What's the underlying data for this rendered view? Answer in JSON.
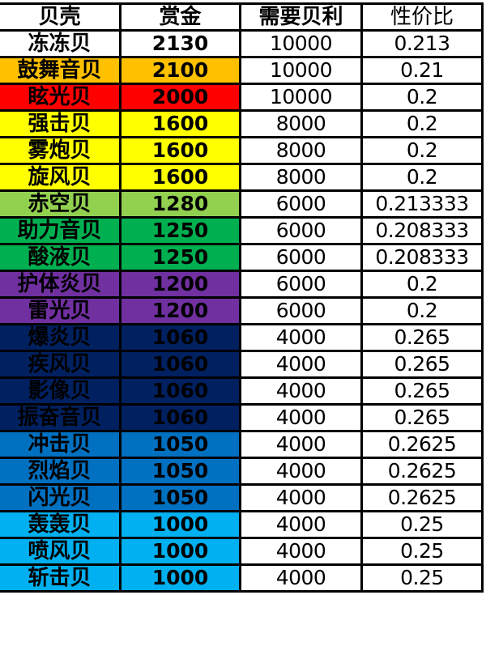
{
  "headers": {
    "shell": "贝壳",
    "bounty": "赏金",
    "required_berry": "需要贝利",
    "value_ratio": "性价比"
  },
  "tier_colors": {
    "white": "#FFFFFF",
    "orange": "#FFC000",
    "red": "#FF0000",
    "yellow": "#FFFF00",
    "light_green": "#92D050",
    "green": "#00B050",
    "purple": "#7030A0",
    "navy": "#002060",
    "blue": "#0070C0",
    "light_blue": "#00B0F0"
  },
  "rows": [
    {
      "name": "冻冻贝",
      "bounty": "2130",
      "berry": "10000",
      "ratio": "0.213",
      "tier": "white"
    },
    {
      "name": "鼓舞音贝",
      "bounty": "2100",
      "berry": "10000",
      "ratio": "0.21",
      "tier": "orange"
    },
    {
      "name": "眩光贝",
      "bounty": "2000",
      "berry": "10000",
      "ratio": "0.2",
      "tier": "red"
    },
    {
      "name": "强击贝",
      "bounty": "1600",
      "berry": "8000",
      "ratio": "0.2",
      "tier": "yellow"
    },
    {
      "name": "雾炮贝",
      "bounty": "1600",
      "berry": "8000",
      "ratio": "0.2",
      "tier": "yellow"
    },
    {
      "name": "旋风贝",
      "bounty": "1600",
      "berry": "8000",
      "ratio": "0.2",
      "tier": "yellow"
    },
    {
      "name": "赤空贝",
      "bounty": "1280",
      "berry": "6000",
      "ratio": "0.213333",
      "tier": "light_green"
    },
    {
      "name": "助力音贝",
      "bounty": "1250",
      "berry": "6000",
      "ratio": "0.208333",
      "tier": "green"
    },
    {
      "name": "酸液贝",
      "bounty": "1250",
      "berry": "6000",
      "ratio": "0.208333",
      "tier": "green"
    },
    {
      "name": "护体炎贝",
      "bounty": "1200",
      "berry": "6000",
      "ratio": "0.2",
      "tier": "purple"
    },
    {
      "name": "雷光贝",
      "bounty": "1200",
      "berry": "6000",
      "ratio": "0.2",
      "tier": "purple"
    },
    {
      "name": "爆炎贝",
      "bounty": "1060",
      "berry": "4000",
      "ratio": "0.265",
      "tier": "navy"
    },
    {
      "name": "疾风贝",
      "bounty": "1060",
      "berry": "4000",
      "ratio": "0.265",
      "tier": "navy"
    },
    {
      "name": "影像贝",
      "bounty": "1060",
      "berry": "4000",
      "ratio": "0.265",
      "tier": "navy"
    },
    {
      "name": "振奋音贝",
      "bounty": "1060",
      "berry": "4000",
      "ratio": "0.265",
      "tier": "navy"
    },
    {
      "name": "冲击贝",
      "bounty": "1050",
      "berry": "4000",
      "ratio": "0.2625",
      "tier": "blue"
    },
    {
      "name": "烈焰贝",
      "bounty": "1050",
      "berry": "4000",
      "ratio": "0.2625",
      "tier": "blue"
    },
    {
      "name": "闪光贝",
      "bounty": "1050",
      "berry": "4000",
      "ratio": "0.2625",
      "tier": "blue"
    },
    {
      "name": "轰轰贝",
      "bounty": "1000",
      "berry": "4000",
      "ratio": "0.25",
      "tier": "light_blue"
    },
    {
      "name": "喷风贝",
      "bounty": "1000",
      "berry": "4000",
      "ratio": "0.25",
      "tier": "light_blue"
    },
    {
      "name": "斩击贝",
      "bounty": "1000",
      "berry": "4000",
      "ratio": "0.25",
      "tier": "light_blue"
    }
  ]
}
